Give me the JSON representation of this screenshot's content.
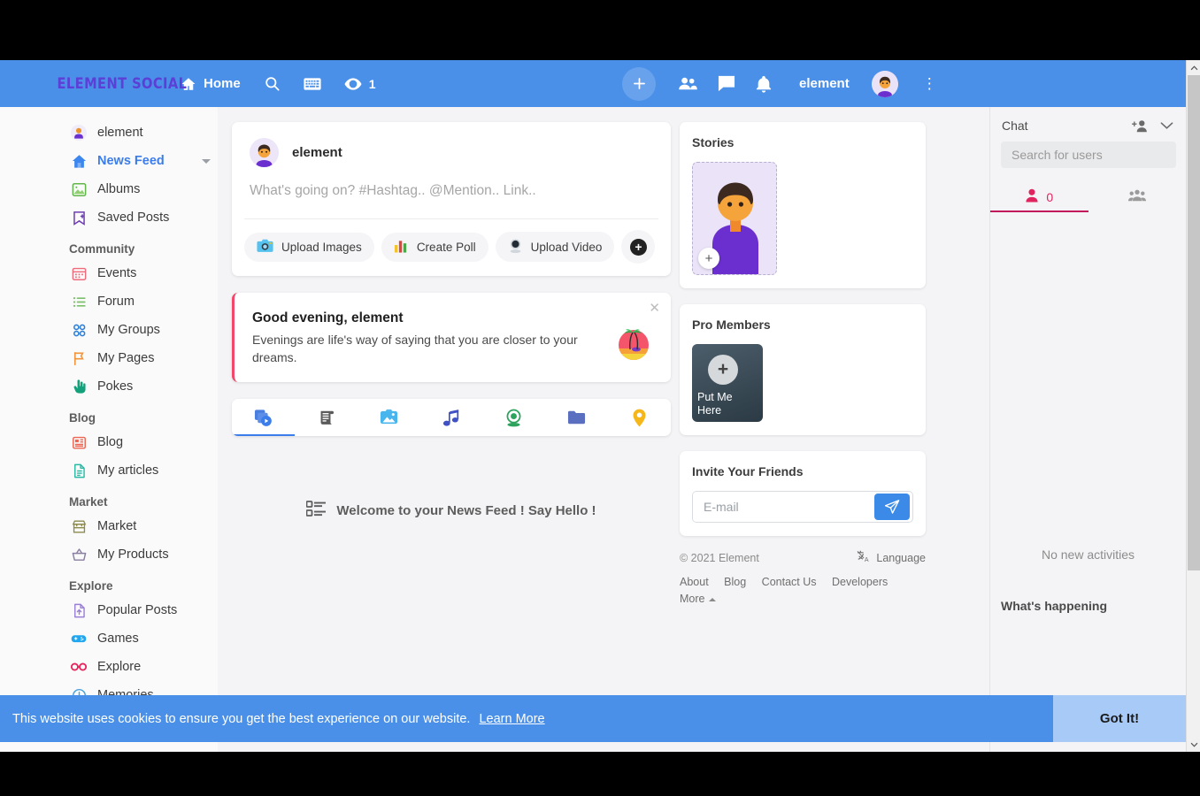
{
  "header": {
    "logo": "ELEMENT SOCIAL",
    "home_label": "Home",
    "search_icon": "search-icon",
    "keyboard_icon": "keyboard-icon",
    "views_icon": "eye-icon",
    "views_count": "1",
    "add_icon": "plus-icon",
    "friends_icon": "people-icon",
    "messages_icon": "chat-bubble-icon",
    "notifications_icon": "bell-icon",
    "username": "element",
    "menu_icon": "kebab-menu-icon"
  },
  "sidebar": {
    "top_items": [
      {
        "label": "element",
        "icon": "user-avatar-icon"
      },
      {
        "label": "News Feed",
        "icon": "home-icon",
        "active": true,
        "caret": true
      },
      {
        "label": "Albums",
        "icon": "photo-album-icon"
      },
      {
        "label": "Saved Posts",
        "icon": "bookmark-plus-icon"
      }
    ],
    "sections": [
      {
        "title": "Community",
        "items": [
          {
            "label": "Events",
            "icon": "calendar-icon"
          },
          {
            "label": "Forum",
            "icon": "list-icon"
          },
          {
            "label": "My Groups",
            "icon": "groups-grid-icon"
          },
          {
            "label": "My Pages",
            "icon": "flag-icon"
          },
          {
            "label": "Pokes",
            "icon": "hand-poke-icon"
          }
        ]
      },
      {
        "title": "Blog",
        "items": [
          {
            "label": "Blog",
            "icon": "newspaper-icon"
          },
          {
            "label": "My articles",
            "icon": "document-icon"
          }
        ]
      },
      {
        "title": "Market",
        "items": [
          {
            "label": "Market",
            "icon": "storefront-icon"
          },
          {
            "label": "My Products",
            "icon": "basket-icon"
          }
        ]
      },
      {
        "title": "Explore",
        "items": [
          {
            "label": "Popular Posts",
            "icon": "file-up-icon"
          },
          {
            "label": "Games",
            "icon": "gamepad-icon"
          },
          {
            "label": "Explore",
            "icon": "glasses-icon"
          },
          {
            "label": "Memories",
            "icon": "clock-history-icon"
          }
        ]
      }
    ]
  },
  "composer": {
    "author": "element",
    "placeholder": "What's going on? #Hashtag.. @Mention.. Link..",
    "value": "",
    "actions": [
      {
        "label": "Upload Images",
        "icon": "camera-icon"
      },
      {
        "label": "Create Poll",
        "icon": "bar-chart-icon"
      },
      {
        "label": "Upload Video",
        "icon": "webcam-icon"
      }
    ],
    "more_icon": "plus-circle-icon"
  },
  "greeting": {
    "title": "Good evening, element",
    "text": "Evenings are life's way of saying that you are closer to your dreams.",
    "emoji": "sunset-palm-icon",
    "close_icon": "close-icon"
  },
  "filter_tabs": [
    {
      "icon": "all-posts-icon",
      "active": true
    },
    {
      "icon": "article-scroll-icon",
      "active": false
    },
    {
      "icon": "image-icon",
      "active": false
    },
    {
      "icon": "music-note-icon",
      "active": false
    },
    {
      "icon": "webcam-video-icon",
      "active": false
    },
    {
      "icon": "folder-icon",
      "active": false
    },
    {
      "icon": "location-pin-icon",
      "active": false
    }
  ],
  "feed": {
    "welcome_icon": "feed-list-icon",
    "welcome_text": "Welcome to your News Feed ! Say Hello !"
  },
  "stories": {
    "title": "Stories",
    "add_icon": "plus-icon"
  },
  "pro_members": {
    "title": "Pro Members",
    "tile_label": "Put Me Here",
    "tile_icon": "plus-icon"
  },
  "invite": {
    "title": "Invite Your Friends",
    "placeholder": "E-mail",
    "value": "",
    "send_icon": "send-paper-plane-icon"
  },
  "footer": {
    "copyright": "© 2021 Element",
    "language_icon": "translate-icon",
    "language_label": "Language",
    "links": [
      "About",
      "Blog",
      "Contact Us",
      "Developers"
    ],
    "more_label": "More"
  },
  "chat": {
    "title": "Chat",
    "add_user_icon": "add-person-icon",
    "collapse_icon": "chevron-down-icon",
    "search_placeholder": "Search for users",
    "search_value": "",
    "tabs": [
      {
        "icon": "person-icon",
        "count": "0",
        "active": true
      },
      {
        "icon": "group-people-icon",
        "count": "",
        "active": false
      }
    ],
    "whats_happening_title": "What's happening",
    "whats_happening_empty": "No new activities"
  },
  "cookie": {
    "text": "This website uses cookies to ensure you get the best experience on our website.",
    "link": "Learn More",
    "button": "Got It!"
  },
  "colors": {
    "header_blue": "#4a90e8",
    "accent_blue": "#3b7dea",
    "logo_purple": "#5b3fd6",
    "chat_accent": "#c2185b",
    "greeting_bar": "#f2466b"
  }
}
